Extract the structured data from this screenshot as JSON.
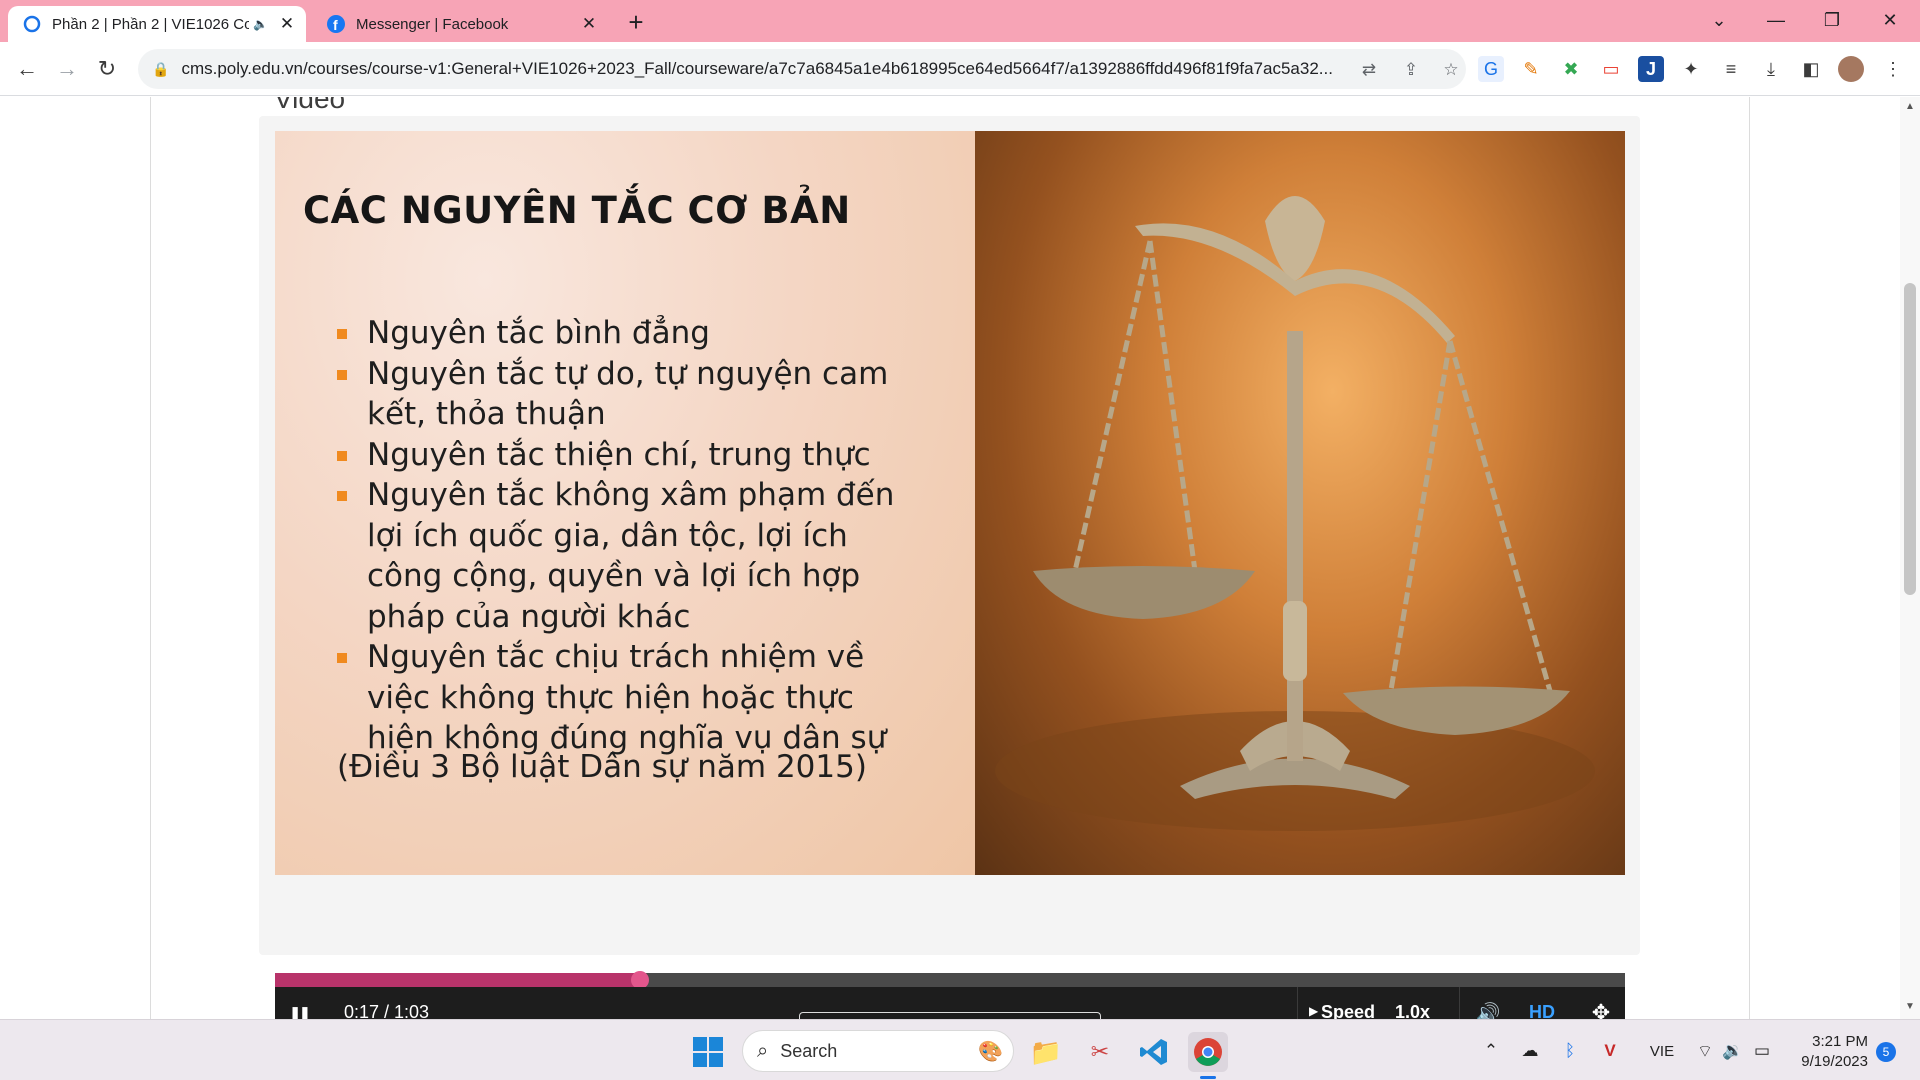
{
  "browser": {
    "tabs": [
      {
        "title": "Phần 2 | Phần 2 | VIE1026 Cơ",
        "icon": "loading-icon",
        "audio": true
      },
      {
        "title": "Messenger | Facebook",
        "icon": "facebook-icon"
      }
    ],
    "url": "cms.poly.edu.vn/courses/course-v1:General+VIE1026+2023_Fall/courseware/a7c7a6845a1e4b618995ce64ed5664f7/a1392886ffdd496f81f9fa7ac5a32..."
  },
  "page": {
    "section_title": "Video"
  },
  "slide": {
    "title": "CÁC NGUYÊN TẮC CƠ BẢN",
    "bullets": [
      "Nguyên tắc bình đẳng",
      "Nguyên tắc tự do, tự nguyện cam kết, thỏa thuận",
      "Nguyên tắc thiện chí, trung thực",
      "Nguyên tắc không xâm phạm đến lợi ích quốc gia, dân tộc, lợi ích công cộng, quyền và lợi ích hợp pháp của người khác",
      "Nguyên tắc chịu trách nhiệm về việc không thực hiện hoặc thực hiện không đúng nghĩa vụ dân sự"
    ],
    "citation": "(Điều 3 Bộ luật Dân sự năm 2015)",
    "image": "scales-of-justice"
  },
  "player": {
    "time": "0:17 / 1:03",
    "progress": 0.27,
    "speed_label": "Speed",
    "speed_value": "1.0x",
    "hd_label": "HD",
    "progress_color": "#b8336a"
  },
  "taskbar": {
    "search_label": "Search",
    "language": "VIE",
    "time": "3:21 PM",
    "date": "9/19/2023",
    "notifications": "5"
  }
}
